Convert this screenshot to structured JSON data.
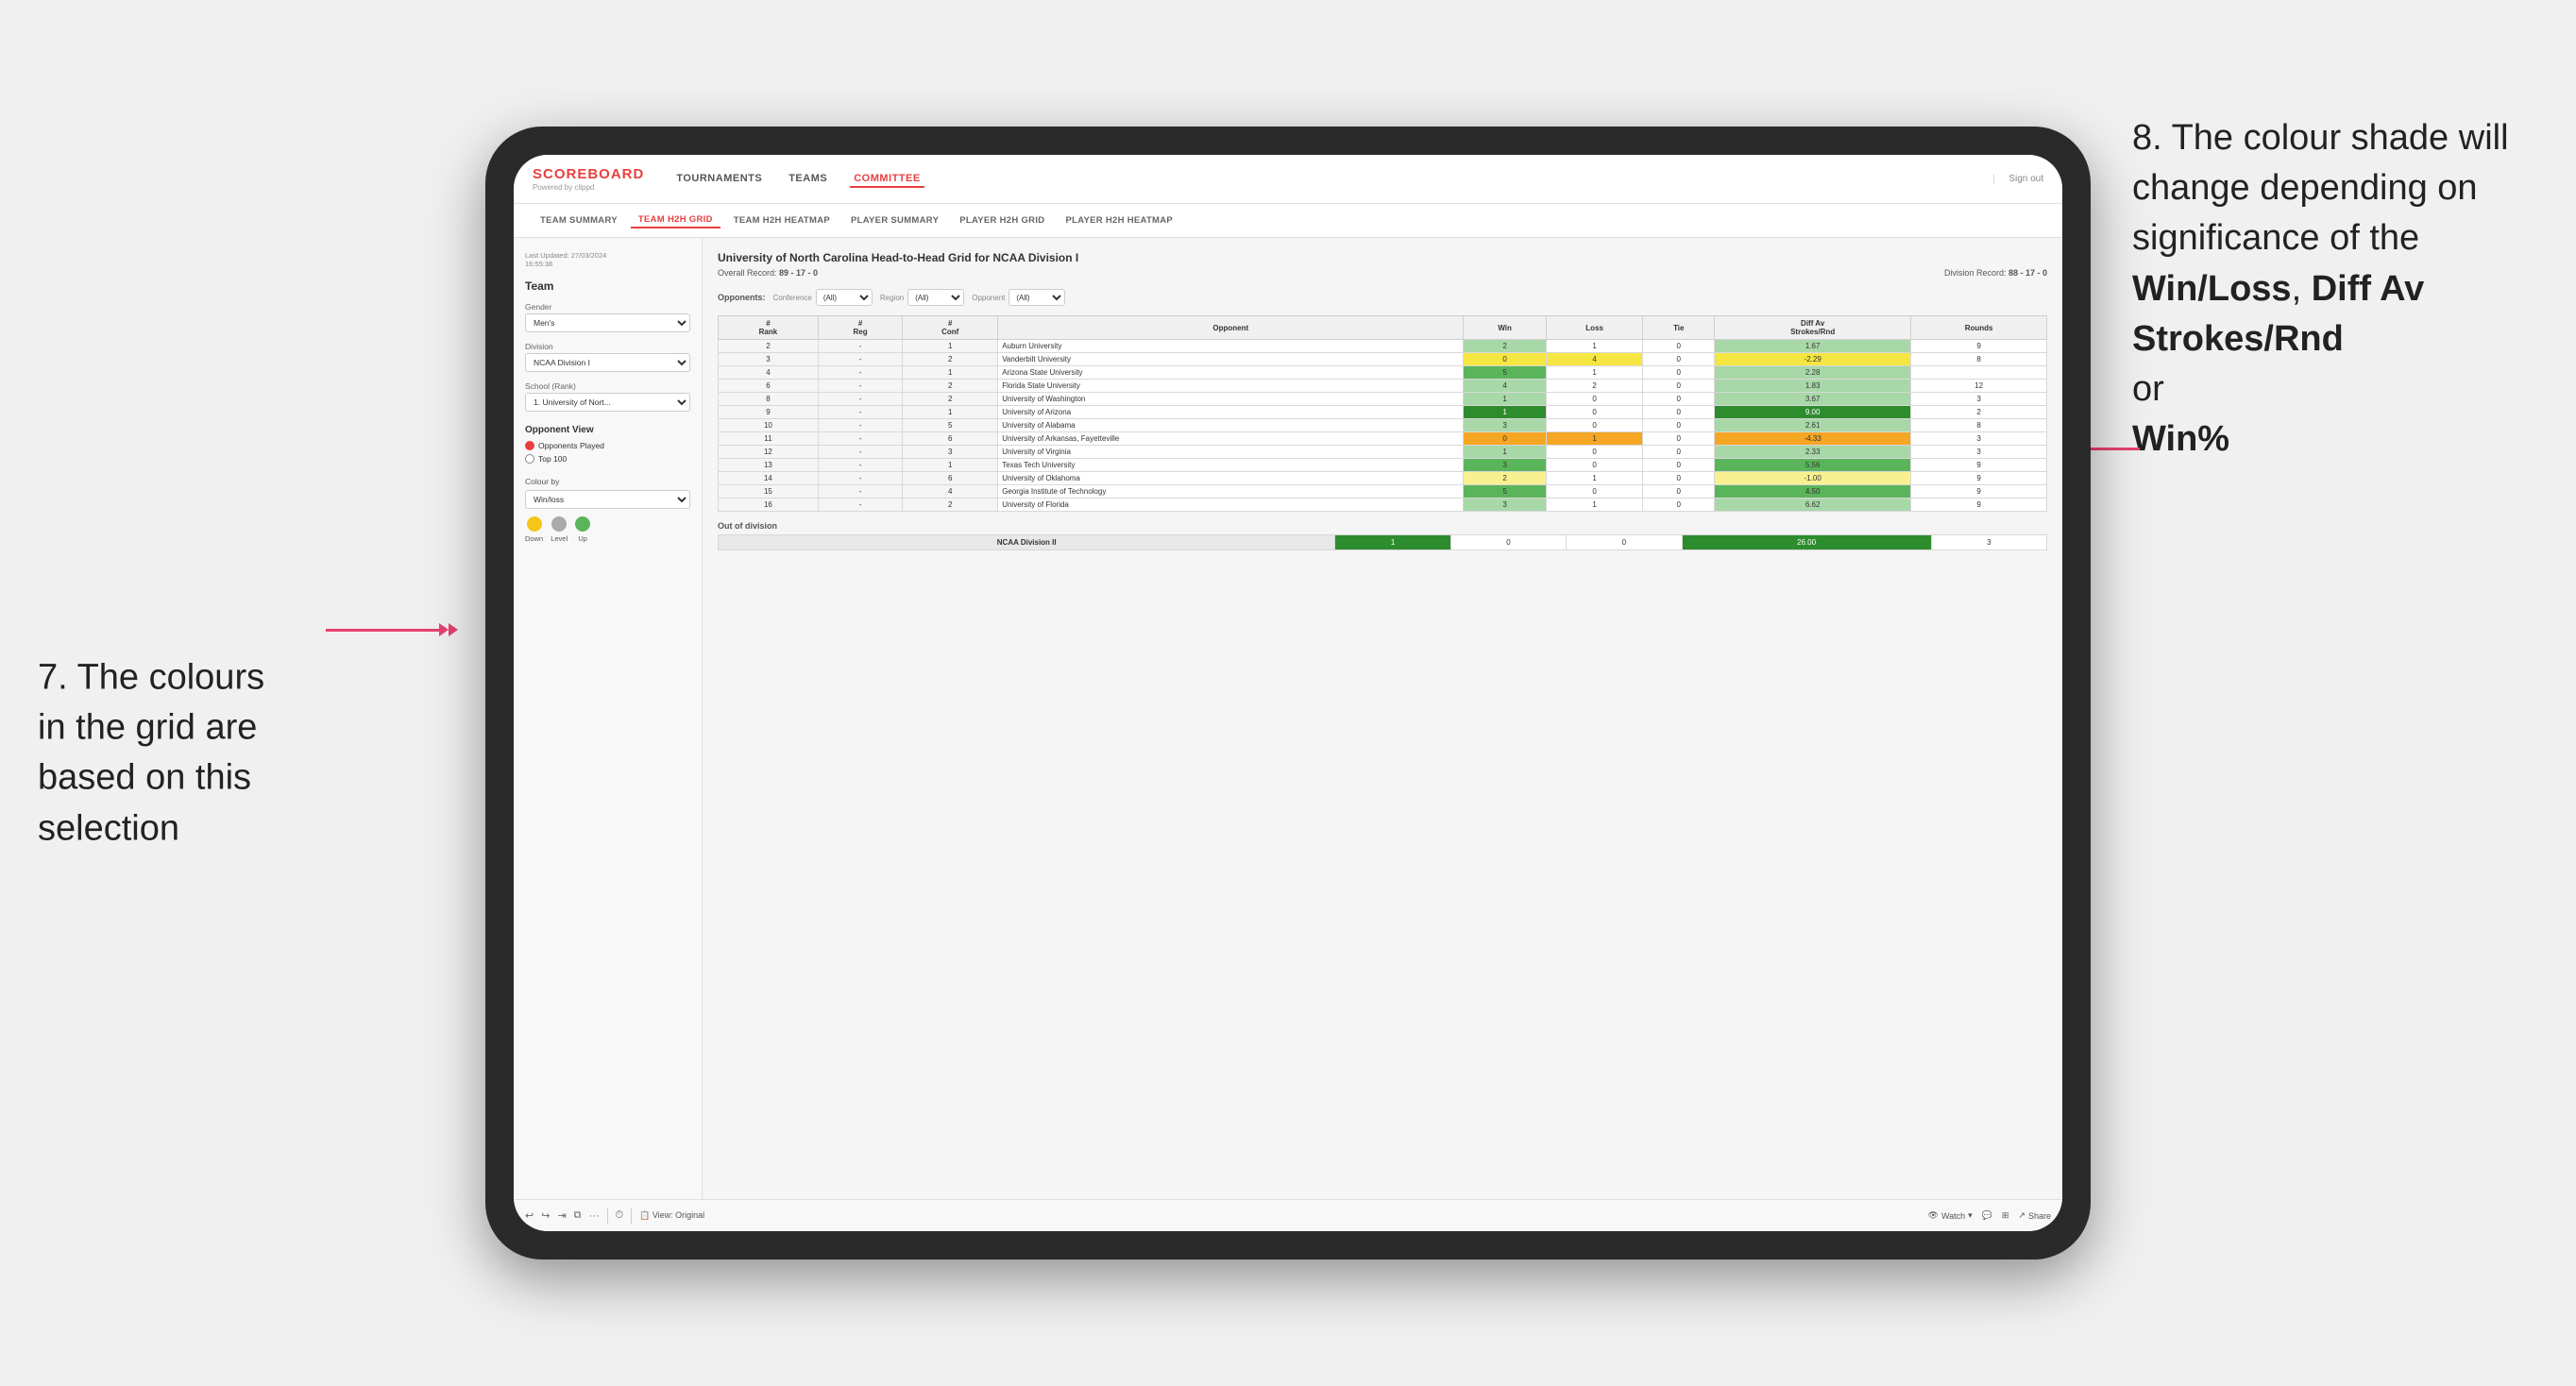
{
  "annotations": {
    "left_title": "7. The colours in the grid are based on this selection",
    "right_title": "8. The colour shade will change depending on significance of the",
    "right_bold1": "Win/Loss",
    "right_sep1": ", ",
    "right_bold2": "Diff Av Strokes/Rnd",
    "right_sep2": " or",
    "right_bold3": "Win%"
  },
  "app": {
    "logo": "SCOREBOARD",
    "logo_sub": "Powered by clippd",
    "nav": [
      "TOURNAMENTS",
      "TEAMS",
      "COMMITTEE"
    ],
    "sign_out": "Sign out",
    "active_nav": "COMMITTEE"
  },
  "sub_tabs": [
    "TEAM SUMMARY",
    "TEAM H2H GRID",
    "TEAM H2H HEATMAP",
    "PLAYER SUMMARY",
    "PLAYER H2H GRID",
    "PLAYER H2H HEATMAP"
  ],
  "active_sub_tab": "TEAM H2H GRID",
  "sidebar": {
    "last_updated_label": "Last Updated: 27/03/2024",
    "last_updated_time": "16:55:38",
    "team_label": "Team",
    "gender_label": "Gender",
    "gender_value": "Men's",
    "division_label": "Division",
    "division_value": "NCAA Division I",
    "school_label": "School (Rank)",
    "school_value": "1. University of Nort...",
    "opponent_view_title": "Opponent View",
    "radio_options": [
      "Opponents Played",
      "Top 100"
    ],
    "selected_radio": "Opponents Played",
    "colour_by_label": "Colour by",
    "colour_by_value": "Win/loss",
    "legend": {
      "down_label": "Down",
      "level_label": "Level",
      "up_label": "Up"
    }
  },
  "grid": {
    "title": "University of North Carolina Head-to-Head Grid for NCAA Division I",
    "overall_record": "89 - 17 - 0",
    "division_record": "88 - 17 - 0",
    "filter_opponents_label": "Opponents:",
    "filter_conference_label": "Conference",
    "filter_region_label": "Region",
    "filter_opponent_label": "Opponent",
    "filter_all": "(All)",
    "columns": [
      "#\nRank",
      "#\nReg",
      "#\nConf",
      "Opponent",
      "Win",
      "Loss",
      "Tie",
      "Diff Av\nStrokes/Rnd",
      "Rounds"
    ],
    "rows": [
      {
        "rank": "2",
        "reg": "-",
        "conf": "1",
        "opponent": "Auburn University",
        "win": "2",
        "loss": "1",
        "tie": "0",
        "diff": "1.67",
        "rounds": "9",
        "win_color": "green-light",
        "loss_color": "white",
        "diff_color": "green-light"
      },
      {
        "rank": "3",
        "reg": "-",
        "conf": "2",
        "opponent": "Vanderbilt University",
        "win": "0",
        "loss": "4",
        "tie": "0",
        "diff": "-2.29",
        "rounds": "8",
        "win_color": "yellow",
        "loss_color": "yellow",
        "diff_color": "yellow"
      },
      {
        "rank": "4",
        "reg": "-",
        "conf": "1",
        "opponent": "Arizona State University",
        "win": "5",
        "loss": "1",
        "tie": "0",
        "diff": "2.28",
        "rounds": "",
        "win_color": "green-med",
        "loss_color": "white",
        "diff_color": "green-light"
      },
      {
        "rank": "6",
        "reg": "-",
        "conf": "2",
        "opponent": "Florida State University",
        "win": "4",
        "loss": "2",
        "tie": "0",
        "diff": "1.83",
        "rounds": "12",
        "win_color": "green-light",
        "loss_color": "white",
        "diff_color": "green-light"
      },
      {
        "rank": "8",
        "reg": "-",
        "conf": "2",
        "opponent": "University of Washington",
        "win": "1",
        "loss": "0",
        "tie": "0",
        "diff": "3.67",
        "rounds": "3",
        "win_color": "green-light",
        "loss_color": "white",
        "diff_color": "green-light"
      },
      {
        "rank": "9",
        "reg": "-",
        "conf": "1",
        "opponent": "University of Arizona",
        "win": "1",
        "loss": "0",
        "tie": "0",
        "diff": "9.00",
        "rounds": "2",
        "win_color": "green-dark",
        "loss_color": "white",
        "diff_color": "green-dark"
      },
      {
        "rank": "10",
        "reg": "-",
        "conf": "5",
        "opponent": "University of Alabama",
        "win": "3",
        "loss": "0",
        "tie": "0",
        "diff": "2.61",
        "rounds": "8",
        "win_color": "green-light",
        "loss_color": "white",
        "diff_color": "green-light"
      },
      {
        "rank": "11",
        "reg": "-",
        "conf": "6",
        "opponent": "University of Arkansas, Fayetteville",
        "win": "0",
        "loss": "1",
        "tie": "0",
        "diff": "-4.33",
        "rounds": "3",
        "win_color": "orange",
        "loss_color": "orange",
        "diff_color": "orange"
      },
      {
        "rank": "12",
        "reg": "-",
        "conf": "3",
        "opponent": "University of Virginia",
        "win": "1",
        "loss": "0",
        "tie": "0",
        "diff": "2.33",
        "rounds": "3",
        "win_color": "green-light",
        "loss_color": "white",
        "diff_color": "green-light"
      },
      {
        "rank": "13",
        "reg": "-",
        "conf": "1",
        "opponent": "Texas Tech University",
        "win": "3",
        "loss": "0",
        "tie": "0",
        "diff": "5.56",
        "rounds": "9",
        "win_color": "green-med",
        "loss_color": "white",
        "diff_color": "green-med"
      },
      {
        "rank": "14",
        "reg": "-",
        "conf": "6",
        "opponent": "University of Oklahoma",
        "win": "2",
        "loss": "1",
        "tie": "0",
        "diff": "-1.00",
        "rounds": "9",
        "win_color": "yellow-light",
        "loss_color": "white",
        "diff_color": "yellow-light"
      },
      {
        "rank": "15",
        "reg": "-",
        "conf": "4",
        "opponent": "Georgia Institute of Technology",
        "win": "5",
        "loss": "0",
        "tie": "0",
        "diff": "4.50",
        "rounds": "9",
        "win_color": "green-med",
        "loss_color": "white",
        "diff_color": "green-med"
      },
      {
        "rank": "16",
        "reg": "-",
        "conf": "2",
        "opponent": "University of Florida",
        "win": "3",
        "loss": "1",
        "tie": "0",
        "diff": "6.62",
        "rounds": "9",
        "win_color": "green-light",
        "loss_color": "white",
        "diff_color": "green-light"
      }
    ],
    "out_of_division_label": "Out of division",
    "out_of_division_rows": [
      {
        "division": "NCAA Division II",
        "win": "1",
        "loss": "0",
        "tie": "0",
        "diff": "26.00",
        "rounds": "3",
        "win_color": "green-dark",
        "diff_color": "green-dark"
      }
    ]
  },
  "toolbar": {
    "view_label": "View: Original",
    "watch_label": "Watch",
    "share_label": "Share"
  }
}
